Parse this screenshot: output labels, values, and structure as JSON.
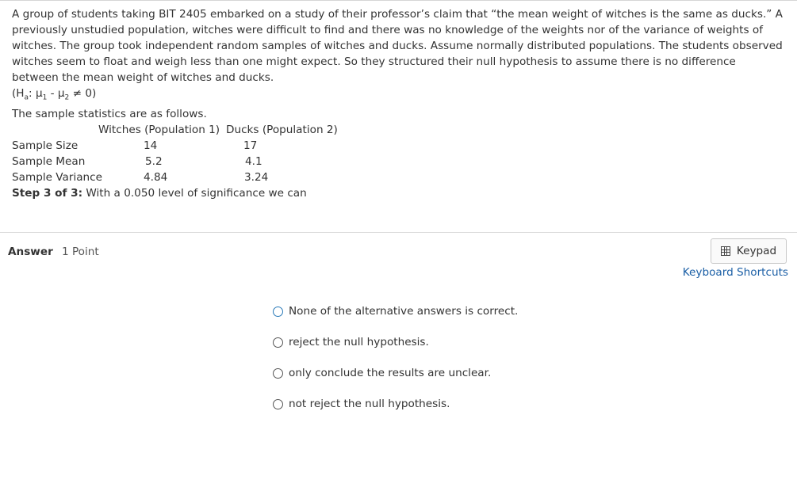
{
  "question": {
    "paragraph": "A group of students taking BIT 2405 embarked on a study of their professor’s claim that “the mean weight of witches is the same as ducks.” A previously unstudied population, witches were difficult to find and there was no knowledge of the weights nor of the variance of weights of witches. The group took independent random samples of witches and ducks. Assume normally distributed populations. The students observed witches seem to float and weigh less than one might expect. So they structured their null hypothesis to assume there is no difference between the mean weight of witches and ducks.",
    "hypothesis_open": "(H",
    "hypothesis_sub": "a",
    "hypothesis_mu1": ": μ",
    "hypothesis_sub1": "1",
    "hypothesis_mid": " - μ",
    "hypothesis_sub2": "2",
    "hypothesis_close": " ≠ 0)",
    "stats_intro": "The sample statistics are as follows."
  },
  "stats_table": {
    "header_pop1": "Witches (Population 1)",
    "header_pop2": "Ducks (Population 2)",
    "rows": [
      {
        "label": "Sample Size",
        "pop1": "14",
        "pop2": "17"
      },
      {
        "label": "Sample Mean",
        "pop1": "5.2",
        "pop2": "4.1"
      },
      {
        "label": "Sample Variance",
        "pop1": "4.84",
        "pop2": "3.24"
      }
    ]
  },
  "step": {
    "label": "Step 3 of 3:",
    "text": " With a 0.050 level of significance we can"
  },
  "answer": {
    "label": "Answer",
    "points": "1 Point",
    "keypad_label": "Keypad",
    "shortcuts_label": "Keyboard Shortcuts",
    "options": [
      {
        "label": "None of the alternative answers is correct."
      },
      {
        "label": "reject the null hypothesis."
      },
      {
        "label": "only conclude the results are unclear."
      },
      {
        "label": "not reject the null hypothesis."
      }
    ]
  },
  "colors": {
    "link": "#1b5fa6",
    "radio_focus": "#2a7ab8",
    "divider": "#dcdcdc"
  },
  "icons": {
    "keypad": "keypad-grid-icon",
    "radio": "radio-button-icon"
  }
}
